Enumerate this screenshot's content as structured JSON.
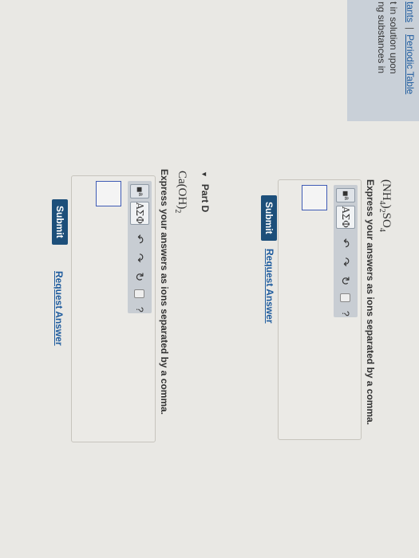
{
  "top": {
    "link_constants": "tants",
    "separator": "|",
    "link_periodic": "Periodic Table",
    "intro_line1": "t in solution upon",
    "intro_line2": "ng substances in"
  },
  "part_c": {
    "formula_html": "(NH<sub>4</sub>)<sub>2</sub>SO<sub>4</sub>",
    "instruction": "Express your answers as ions separated by a comma.",
    "greek_label": "ΑΣΦ",
    "submit_label": "Submit",
    "request_label": "Request Answer"
  },
  "part_d": {
    "heading": "Part D",
    "formula_html": "Ca(OH)<sub>2</sub>",
    "instruction": "Express your answers as ions separated by a comma.",
    "greek_label": "ΑΣΦ",
    "submit_label": "Submit",
    "request_label": "Request Answer"
  },
  "icons": {
    "undo": "↶",
    "redo": "↷",
    "reset": "↻",
    "keyboard": "▭",
    "help": "?"
  },
  "colors": {
    "link": "#1f5c9e",
    "submit_bg": "#1d4f7a",
    "input_border": "#3f5bb5"
  }
}
